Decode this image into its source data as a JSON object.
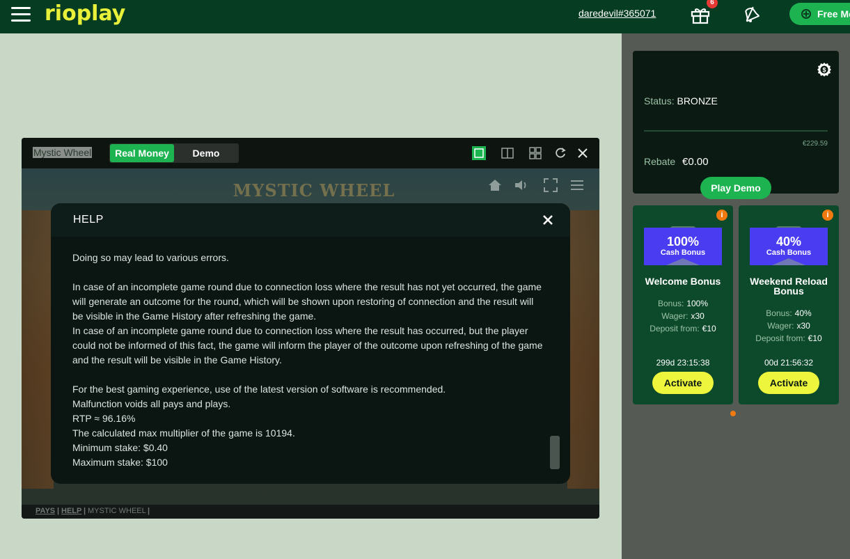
{
  "header": {
    "logo": "rioplay",
    "username": "daredevil#365071",
    "gift_badge": "6",
    "free_mode_label": "Free Mo"
  },
  "sidebar": {
    "status_label": "Status:",
    "status_value": "BRONZE",
    "progress_amount": "€229.59",
    "progress_fraction": 0.0,
    "rebate_label": "Rebate",
    "rebate_value": "€0.00",
    "play_demo": "Play Demo",
    "bonuses": [
      {
        "pct": "100%",
        "sub": "Cash Bonus",
        "title": "Welcome Bonus",
        "rows": [
          {
            "label": "Bonus:",
            "value": "100%"
          },
          {
            "label": "Wager:",
            "value": "x30"
          },
          {
            "label": "Deposit from:",
            "value": "€10"
          }
        ],
        "timer": "299d  23:15:38",
        "activate": "Activate"
      },
      {
        "pct": "40%",
        "sub": "Cash Bonus",
        "title": "Weekend Reload Bonus",
        "rows": [
          {
            "label": "Bonus:",
            "value": "40%"
          },
          {
            "label": "Wager:",
            "value": "x30"
          },
          {
            "label": "Deposit from:",
            "value": "€10"
          }
        ],
        "timer": "00d  21:56:32",
        "activate": "Activate"
      }
    ],
    "colors": {
      "accent": "#1db350",
      "activate": "#eef53d",
      "info": "#f07a10",
      "bonus_badge": "#4a3cf0"
    }
  },
  "game": {
    "title": "Mystic Wheel",
    "mode_real": "Real Money",
    "mode_demo": "Demo",
    "art_title": "MYSTIC WHEEL",
    "help": {
      "title": "HELP",
      "paragraphs": [
        "Doing so may lead to various errors.",
        "",
        "In case of an incomplete game round due to connection loss where the result has not yet occurred, the game will generate an outcome for the round, which will be shown upon restoring of connection and the result will be visible in the Game History after refreshing the game.",
        "In case of an incomplete game round due to connection loss where the result has occurred, but the player could not be informed of this fact, the game will inform the player of the outcome upon refreshing of the game and the result will be visible in the Game History.",
        "",
        "For the best gaming experience, use of the latest version of software is recommended.",
        "Malfunction voids all pays and plays.",
        "RTP ≈ 96.16%",
        "The calculated max multiplier of the game is 10194.",
        "Minimum stake: $0.40",
        "Maximum stake: $100"
      ]
    },
    "footer": {
      "pays": "PAYS",
      "sep1": "|",
      "help": "HELP",
      "sep2": "|",
      "name": "MYSTIC WHEEL",
      "sep3": "|"
    }
  }
}
